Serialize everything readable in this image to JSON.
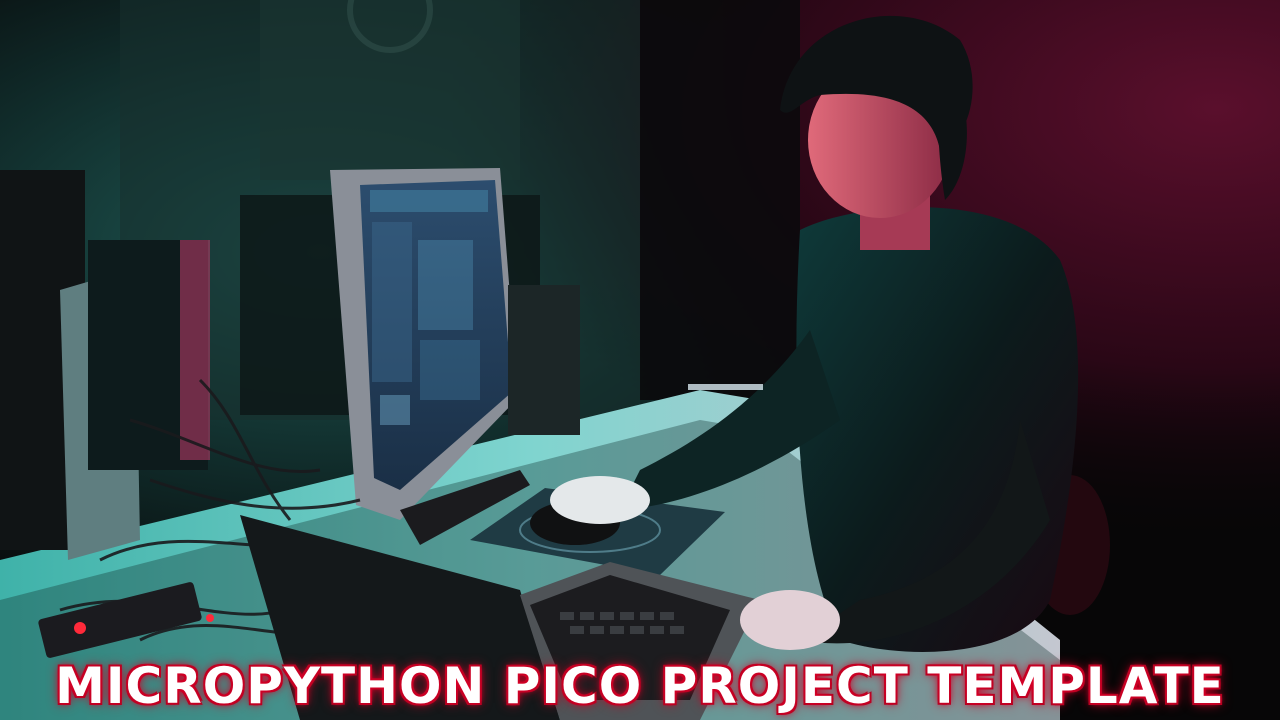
{
  "title": "MICROPYTHON PICO PROJECT TEMPLATE",
  "colors": {
    "background": "#0a0608",
    "teal_light": "#2aa79a",
    "magenta_light": "#c8174e",
    "title_text": "#ffffff",
    "title_glow": "#d4002a"
  },
  "scene": {
    "description_icons": [
      "monitor-icon",
      "laptop-icon",
      "mouse-icon",
      "person-figure"
    ]
  }
}
